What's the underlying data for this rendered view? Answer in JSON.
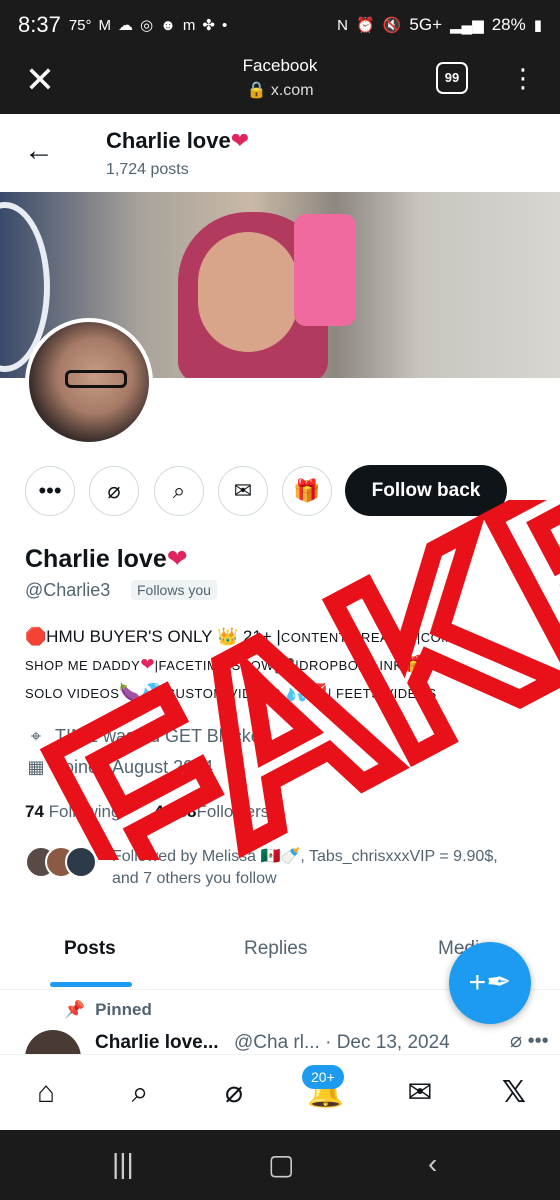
{
  "status_bar": {
    "time": "8:37",
    "temp": "75°",
    "network": "5G+",
    "battery": "28%"
  },
  "browser": {
    "title": "Facebook",
    "url": "x.com",
    "tab_count": "99"
  },
  "profile": {
    "header_name": "Charlie love",
    "posts_count": "1,724 posts",
    "display_name": "Charlie love",
    "handle": "@Charlie3",
    "follows_you": "Follows you",
    "follow_button": "Follow back",
    "bio_line1_a": "HMU BUYER'S ONLY",
    "bio_line1_b": "21+ |",
    "bio_line1_c": "CONTENT CREATOR|COME",
    "bio_line2_a": "SHOP ME DADDY",
    "bio_line2_b": "|FACETIME SHOW",
    "bio_line2_c": "|DROPBOX LINK",
    "bio_line2_d": "|",
    "bio_line3_a": "SOLO VIDEOS",
    "bio_line3_b": "|CUSTOM VIDEOS",
    "bio_line3_c": "| FEETS VIDEOS",
    "location": "TIME wasted GET Blocked",
    "joined": "Joined August 2024",
    "following_count": "74",
    "following_label": "Following",
    "followers_count": "4,688",
    "followers_label": "Followers",
    "followed_by_a": "Followed by Melissa",
    "followed_by_b": ", Tabs_chrisxxxVIP = 9.90$,",
    "followed_by_c": "and 7 others you follow"
  },
  "tabs": [
    "Posts",
    "Replies",
    "Media"
  ],
  "pinned": {
    "label": "Pinned",
    "name": "Charlie love...",
    "handle_date": "@Cha rl... · Dec 13, 2024"
  },
  "bottom_nav": {
    "notifications_badge": "20+"
  },
  "overlay_text": "FAKE",
  "colors": {
    "accent": "#1d9bf0",
    "overlay": "#e8111a",
    "text": "#0f1419",
    "muted": "#536471"
  }
}
